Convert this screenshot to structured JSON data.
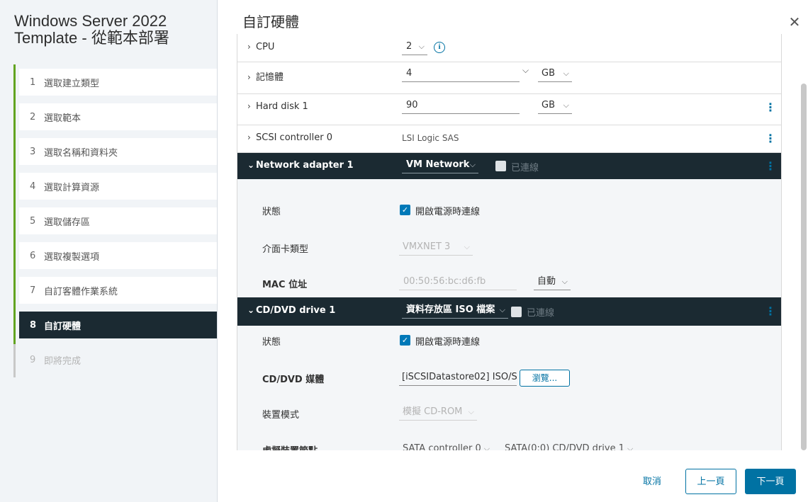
{
  "wizard": {
    "title_line1": "Windows Server 2022",
    "title_line2": "Template - 從範本部署",
    "steps": [
      {
        "num": "1",
        "label": "選取建立類型"
      },
      {
        "num": "2",
        "label": "選取範本"
      },
      {
        "num": "3",
        "label": "選取名稱和資料夾"
      },
      {
        "num": "4",
        "label": "選取計算資源"
      },
      {
        "num": "5",
        "label": "選取儲存區"
      },
      {
        "num": "6",
        "label": "選取複製選項"
      },
      {
        "num": "7",
        "label": "自訂客體作業系統"
      },
      {
        "num": "8",
        "label": "自訂硬體"
      },
      {
        "num": "9",
        "label": "即將完成"
      }
    ],
    "active_step": 8
  },
  "main": {
    "title": "自訂硬體"
  },
  "hardware": {
    "cpu": {
      "label": "CPU",
      "value": "2"
    },
    "memory": {
      "label": "記憶體",
      "value": "4",
      "unit": "GB"
    },
    "hard_disk": {
      "label": "Hard disk 1",
      "value": "90",
      "unit": "GB"
    },
    "scsi": {
      "label": "SCSI controller 0",
      "value": "LSI Logic SAS"
    },
    "network": {
      "label": "Network adapter 1",
      "network": "VM Network",
      "connected_label": "已連線",
      "status_label": "狀態",
      "power_on_label": "開啟電源時連線",
      "adapter_type_label": "介面卡類型",
      "adapter_type": "VMXNET 3",
      "mac_label": "MAC 位址",
      "mac_value": "00:50:56:bc:d6:fb",
      "mac_mode": "自動"
    },
    "cdrom": {
      "label": "CD/DVD drive 1",
      "source": "資料存放區 ISO 檔案",
      "connected_label": "已連線",
      "status_label": "狀態",
      "power_on_label": "開啟電源時連線",
      "media_label": "CD/DVD 媒體",
      "media_value": "[iSCSIDatastore02] ISO/S",
      "browse_label": "瀏覽...",
      "mode_label": "裝置模式",
      "mode_value": "模擬 CD-ROM",
      "node_label": "虛擬裝置節點",
      "node_controller": "SATA controller 0",
      "node_device": "SATA(0:0) CD/DVD drive 1"
    }
  },
  "footer": {
    "cancel": "取消",
    "prev": "上一頁",
    "next": "下一頁"
  }
}
